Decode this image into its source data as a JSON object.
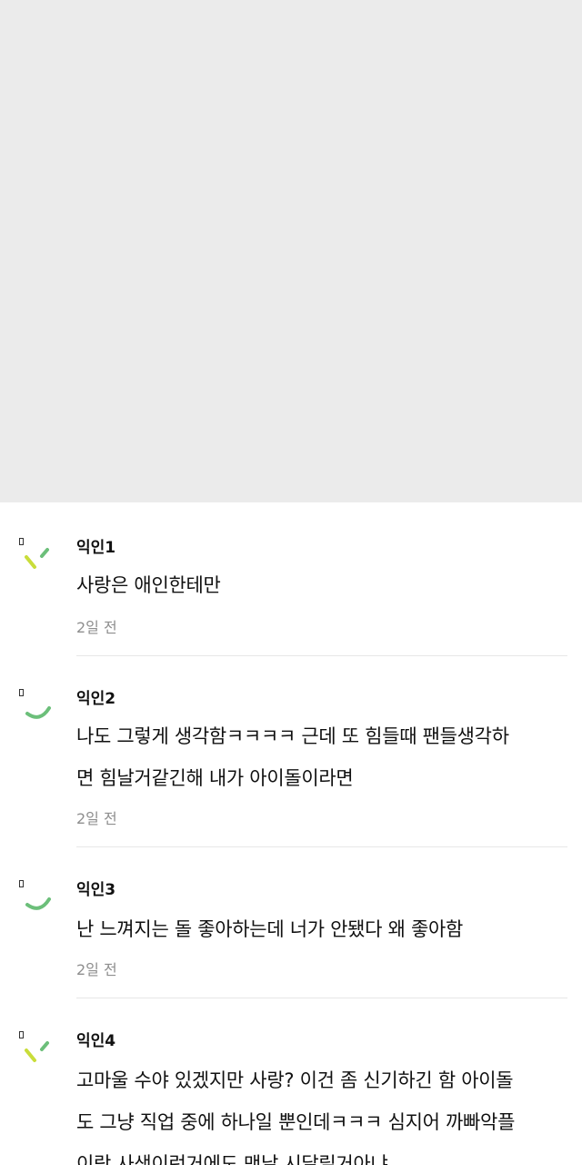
{
  "colors": {
    "placeholder_bg": "#ebebeb",
    "avatar_yellow_green": "#c9dd3a",
    "avatar_green": "#6cbf7a",
    "time_text": "#8e8e8e",
    "divider": "#e7e7e7"
  },
  "comments": [
    {
      "author": "익인1",
      "lines": [
        "사랑은 애인한테만"
      ],
      "time": "2일 전",
      "avatar_icon": "sprout-icon"
    },
    {
      "author": "익인2",
      "lines": [
        "나도 그렇게 생각함ㅋㅋㅋㅋ 근데 또 힘들때 팬들생각하",
        "면 힘날거같긴해 내가 아이돌이라면"
      ],
      "time": "2일 전",
      "avatar_icon": "smile-arc-icon"
    },
    {
      "author": "익인3",
      "lines": [
        "난 느껴지는 돌 좋아하는데 너가 안됐다 왜 좋아함"
      ],
      "time": "2일 전",
      "avatar_icon": "smile-arc-icon"
    },
    {
      "author": "익인4",
      "lines": [
        "고마울 수야 있겠지만 사랑? 이건 좀 신기하긴 함 아이돌",
        "도 그냥 직업 중에 하나일 뿐인데ㅋㅋㅋ 심지어 까빠악플",
        "이랑 사생이런거에도 맨날 시달릴거아냐"
      ],
      "time": "",
      "avatar_icon": "sprout-icon"
    }
  ]
}
